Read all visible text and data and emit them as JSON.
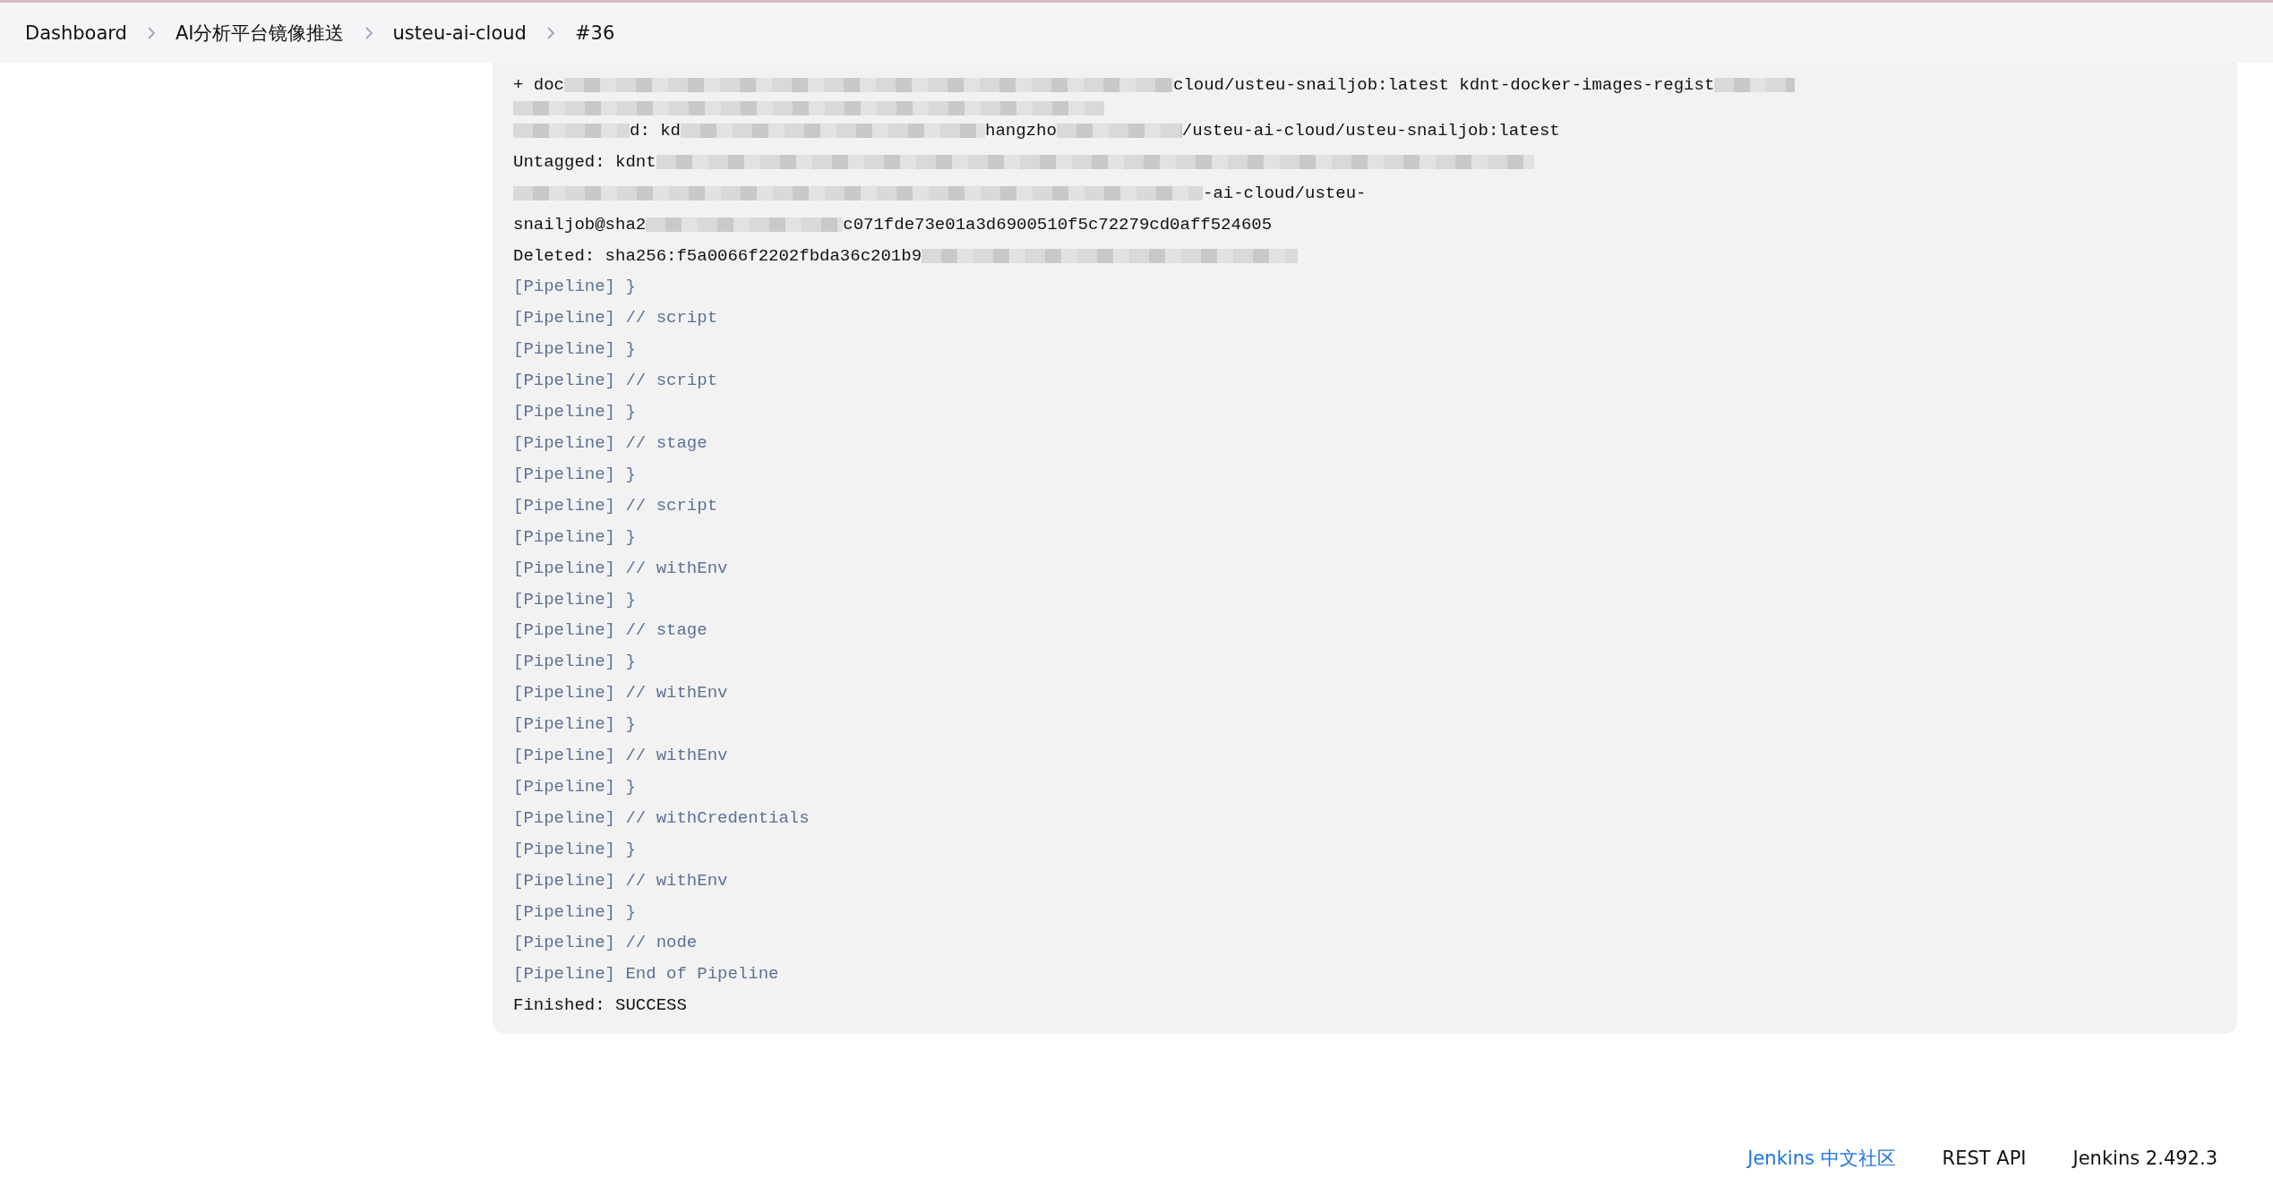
{
  "breadcrumb": [
    {
      "label": "Dashboard"
    },
    {
      "label": "AI分析平台镜像推送"
    },
    {
      "label": "usteu-ai-cloud"
    },
    {
      "label": "#36"
    }
  ],
  "console": [
    {
      "segments": [
        {
          "kind": "text",
          "text": "+ doc"
        },
        {
          "kind": "redacted"
        },
        {
          "kind": "text",
          "text": "cloud/usteu-snailjob:latest kdnt-docker-images-regist"
        },
        {
          "kind": "redacted"
        }
      ]
    },
    {
      "segments": [
        {
          "kind": "redacted"
        }
      ]
    },
    {
      "segments": [
        {
          "kind": "redacted"
        },
        {
          "kind": "text",
          "text": "d: kd"
        },
        {
          "kind": "redacted"
        },
        {
          "kind": "text",
          "text": "hangzho"
        },
        {
          "kind": "redacted"
        },
        {
          "kind": "text",
          "text": "/usteu-ai-cloud/usteu-snailjob:latest"
        }
      ]
    },
    {
      "segments": [
        {
          "kind": "text",
          "text": "Untagged: kdnt"
        },
        {
          "kind": "redacted"
        }
      ]
    },
    {
      "segments": [
        {
          "kind": "redacted"
        },
        {
          "kind": "text",
          "text": "-ai-cloud/usteu-"
        }
      ]
    },
    {
      "segments": [
        {
          "kind": "text",
          "text": "snailjob@sha2"
        },
        {
          "kind": "redacted"
        },
        {
          "kind": "text",
          "text": "c071fde73e01a3d6900510f5c72279cd0aff524605"
        }
      ]
    },
    {
      "segments": [
        {
          "kind": "text",
          "text": "Deleted: sha256:f5a0066f2202fbda36c201b9"
        },
        {
          "kind": "redacted"
        }
      ]
    },
    {
      "kind": "pipeline",
      "text": "[Pipeline] }"
    },
    {
      "kind": "pipeline",
      "text": "[Pipeline] // script"
    },
    {
      "kind": "pipeline",
      "text": "[Pipeline] }"
    },
    {
      "kind": "pipeline",
      "text": "[Pipeline] // script"
    },
    {
      "kind": "pipeline",
      "text": "[Pipeline] }"
    },
    {
      "kind": "pipeline",
      "text": "[Pipeline] // stage"
    },
    {
      "kind": "pipeline",
      "text": "[Pipeline] }"
    },
    {
      "kind": "pipeline",
      "text": "[Pipeline] // script"
    },
    {
      "kind": "pipeline",
      "text": "[Pipeline] }"
    },
    {
      "kind": "pipeline",
      "text": "[Pipeline] // withEnv"
    },
    {
      "kind": "pipeline",
      "text": "[Pipeline] }"
    },
    {
      "kind": "pipeline",
      "text": "[Pipeline] // stage"
    },
    {
      "kind": "pipeline",
      "text": "[Pipeline] }"
    },
    {
      "kind": "pipeline",
      "text": "[Pipeline] // withEnv"
    },
    {
      "kind": "pipeline",
      "text": "[Pipeline] }"
    },
    {
      "kind": "pipeline",
      "text": "[Pipeline] // withEnv"
    },
    {
      "kind": "pipeline",
      "text": "[Pipeline] }"
    },
    {
      "kind": "pipeline",
      "text": "[Pipeline] // withCredentials"
    },
    {
      "kind": "pipeline",
      "text": "[Pipeline] }"
    },
    {
      "kind": "pipeline",
      "text": "[Pipeline] // withEnv"
    },
    {
      "kind": "pipeline",
      "text": "[Pipeline] }"
    },
    {
      "kind": "pipeline",
      "text": "[Pipeline] // node"
    },
    {
      "kind": "pipeline",
      "text": "[Pipeline] End of Pipeline"
    },
    {
      "kind": "output",
      "text": "Finished: SUCCESS"
    }
  ],
  "footer": [
    {
      "label": "Jenkins 中文社区",
      "kind": "link"
    },
    {
      "label": "REST API",
      "kind": "plain"
    },
    {
      "label": "Jenkins 2.492.3",
      "kind": "plain"
    }
  ]
}
